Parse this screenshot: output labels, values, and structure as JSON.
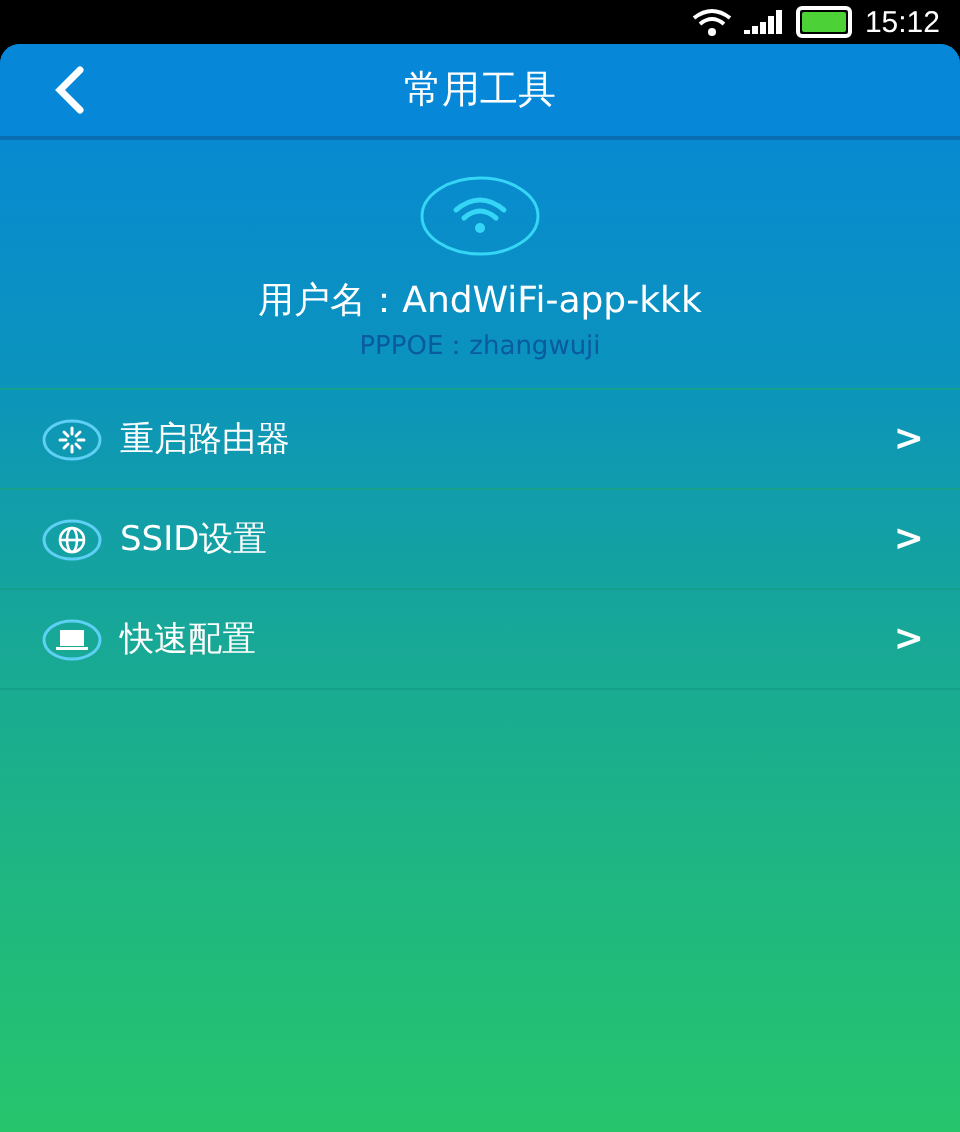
{
  "status_bar": {
    "time": "15:12"
  },
  "header": {
    "title": "常用工具"
  },
  "profile": {
    "username": "用户名：AndWiFi-app-kkk",
    "account": "PPPOE：zhangwuji"
  },
  "menu": [
    {
      "kind": "restart",
      "label": "重启路由器",
      "arrow": ">"
    },
    {
      "kind": "globe",
      "label": "SSID设置",
      "arrow": ">"
    },
    {
      "kind": "laptop",
      "label": "快速配置",
      "arrow": ">"
    }
  ]
}
